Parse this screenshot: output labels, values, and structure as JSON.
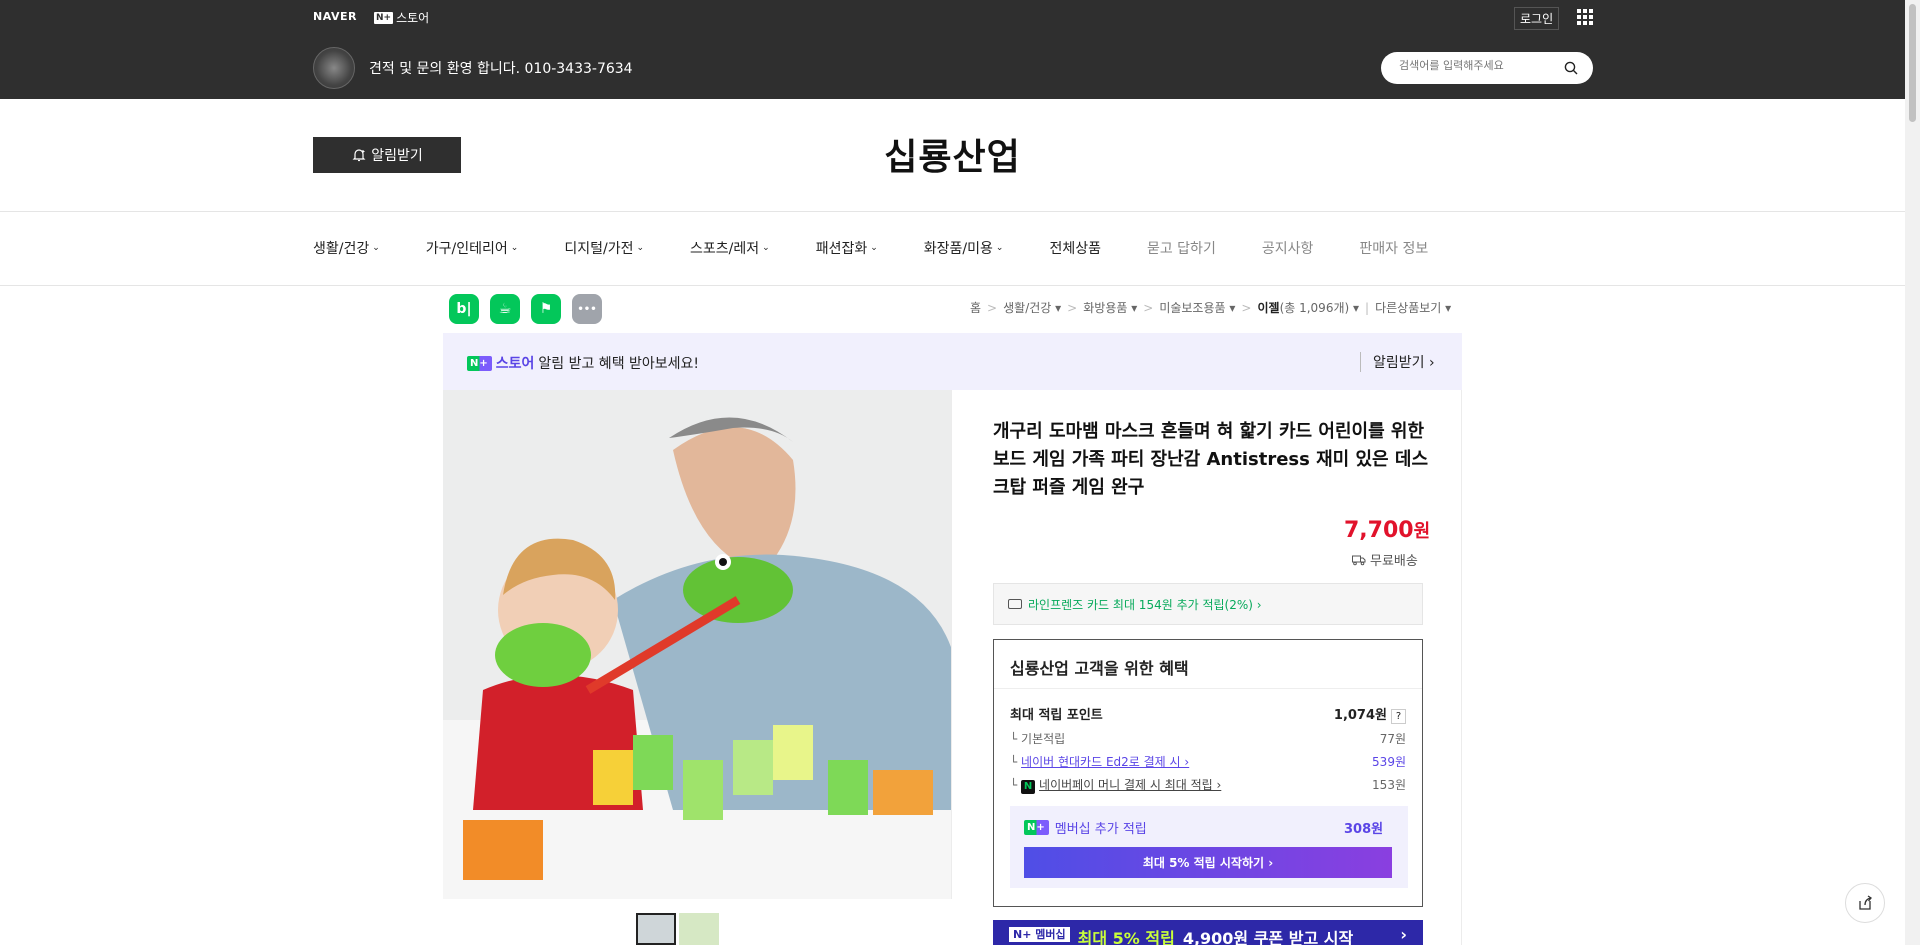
{
  "gnb": {
    "naver_label": "NAVER",
    "nstore_badge": "N+",
    "nstore_label": "스토어",
    "login_label": "로그인",
    "grid_icon": "apps-grid-icon"
  },
  "store": {
    "message": "견적 및 문의 환영 합니다. 010-3433-7634",
    "search_placeholder": "검색어를 입력해주세요",
    "alarm_label": "알림받기",
    "title": "십룡산업"
  },
  "nav": {
    "items": [
      {
        "label": "생활/건강",
        "dropdown": true
      },
      {
        "label": "가구/인테리어",
        "dropdown": true
      },
      {
        "label": "디지털/가전",
        "dropdown": true
      },
      {
        "label": "스포츠/레저",
        "dropdown": true
      },
      {
        "label": "패션잡화",
        "dropdown": true
      },
      {
        "label": "화장품/미용",
        "dropdown": true
      },
      {
        "label": "전체상품",
        "dropdown": false
      },
      {
        "label": "묻고 답하기",
        "dropdown": false
      },
      {
        "label": "공지사항",
        "dropdown": false
      },
      {
        "label": "판매자 정보",
        "dropdown": false
      }
    ]
  },
  "share": {
    "icons": [
      {
        "name": "blog-icon",
        "glyph": "b|",
        "color": "#03c75a"
      },
      {
        "name": "cafe-icon",
        "glyph": "☕",
        "color": "#03c75a"
      },
      {
        "name": "bookmark-icon",
        "glyph": "⚑",
        "color": "#03c75a"
      },
      {
        "name": "more-icon",
        "glyph": "•••",
        "color": "#a0a4ab"
      }
    ]
  },
  "breadcrumb": {
    "home": "홈",
    "cat1": "생활/건강",
    "cat2": "화방용품",
    "cat3": "미술보조용품",
    "current": "이젤",
    "count": "(총 1,096개)",
    "other": "다른상품보기"
  },
  "notice": {
    "badge": "N+",
    "store_word": "스토어",
    "text": "알림 받고 혜택 받아보세요!",
    "action": "알림받기 ›"
  },
  "product": {
    "title": "개구리 도마뱀 마스크 흔들며 혀 핥기 카드 어린이를 위한 보드 게임 가족 파티 장난감 Antistress 재미 있은 데스크탑 퍼즐 게임 완구",
    "price_number": "7,700",
    "price_unit": "원",
    "shipping": "무료배송",
    "card_offer": "라인프렌즈 카드 최대 154원 추가 적립(2%) ›"
  },
  "benefit": {
    "title": "십룡산업 고객을 위한 혜택",
    "max_point_label": "최대 적립 포인트",
    "max_point_value": "1,074원",
    "qmark": "?",
    "rows": [
      {
        "label": "기본적립",
        "value": "77원"
      },
      {
        "label": "네이버 현대카드 Ed2로 결제 시 ›",
        "value": "539원"
      },
      {
        "label": "네이버페이 머니 결제 시 최대 적립 ›",
        "value": "153원"
      }
    ],
    "member_badge": "N+",
    "member_label": "멤버십 추가 적립",
    "member_value": "308원",
    "member_button": "최대 5% 적립 시작하기 ›",
    "banner_badge": "N+ 멤버십",
    "banner_highlight": "최대 5% 적립",
    "banner_text": "4,900원 쿠폰 받고 시작",
    "banner_arrow": "›"
  },
  "colors": {
    "topbar": "#2f2f2f",
    "price": "#e1122b",
    "naver_green": "#03c75a",
    "purple": "#5a45e6"
  }
}
